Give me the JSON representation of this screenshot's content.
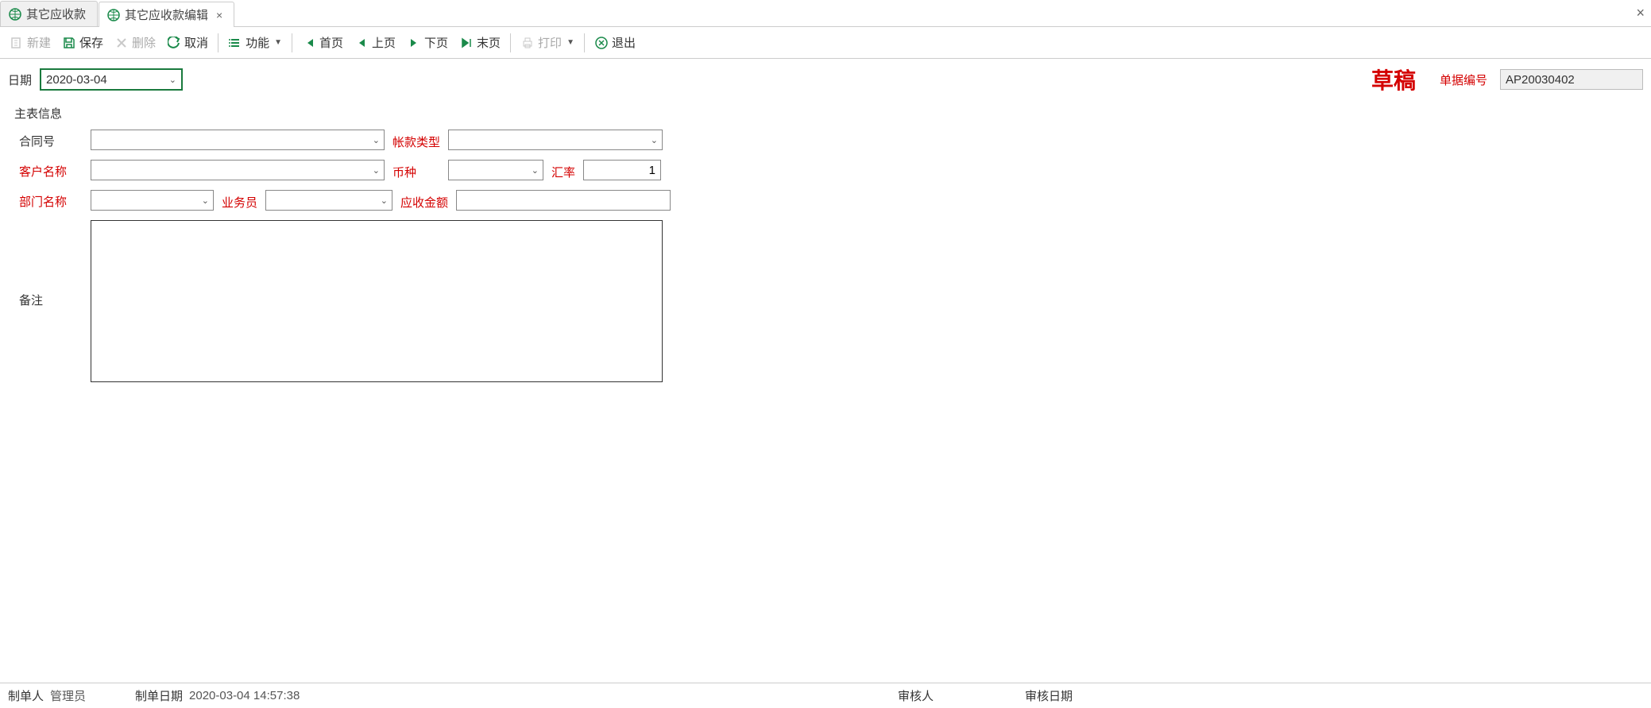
{
  "tabs": {
    "items": [
      {
        "label": "其它应收款",
        "active": false
      },
      {
        "label": "其它应收款编辑",
        "active": true
      }
    ]
  },
  "toolbar": {
    "new": "新建",
    "save": "保存",
    "delete": "删除",
    "cancel": "取消",
    "function": "功能",
    "first": "首页",
    "prev": "上页",
    "next": "下页",
    "last": "末页",
    "print": "打印",
    "exit": "退出"
  },
  "header": {
    "date_label": "日期",
    "date_value": "2020-03-04",
    "draft_stamp": "草稿",
    "doc_no_label": "单据编号",
    "doc_no_value": "AP20030402"
  },
  "form": {
    "legend": "主表信息",
    "labels": {
      "contract_no": "合同号",
      "account_type": "帐款类型",
      "customer_name": "客户名称",
      "currency": "币种",
      "exchange_rate": "汇率",
      "dept_name": "部门名称",
      "salesman": "业务员",
      "amount": "应收金额",
      "remark": "备注"
    },
    "values": {
      "contract_no": "",
      "account_type": "",
      "customer_name": "",
      "currency": "",
      "exchange_rate": "1",
      "dept_name": "",
      "salesman": "",
      "amount": "",
      "remark": ""
    }
  },
  "footer": {
    "creator_label": "制单人",
    "creator_value": "管理员",
    "create_date_label": "制单日期",
    "create_date_value": "2020-03-04 14:57:38",
    "approver_label": "审核人",
    "approver_value": "",
    "approve_date_label": "审核日期",
    "approve_date_value": ""
  }
}
